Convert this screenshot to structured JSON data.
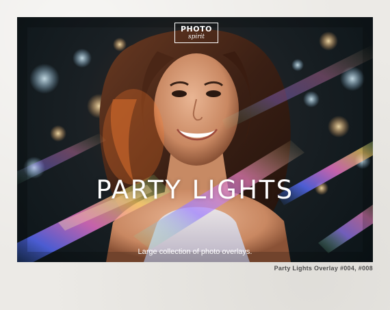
{
  "photo": {
    "logo": {
      "line1": "PHOTO",
      "line2": "spirit"
    },
    "headline": "PARTY LIGHTS",
    "subtitle": "Large collection of photo overlays."
  },
  "caption": "Party Lights Overlay #004, #008"
}
